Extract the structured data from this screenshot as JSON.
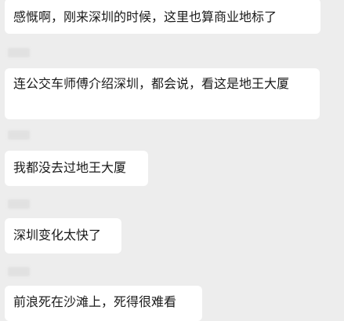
{
  "background_color": "#ededed",
  "bubble_color": "#ffffff",
  "messages": [
    {
      "text": "感慨啊，刚来深圳的时候，这里也算商业地标了"
    },
    {
      "text": "连公交车师傅介绍深圳，都会说，看这是地王大厦"
    },
    {
      "text": "我都没去过地王大厦"
    },
    {
      "text": "深圳变化太快了"
    },
    {
      "text": "前浪死在沙滩上，死得很难看"
    }
  ]
}
